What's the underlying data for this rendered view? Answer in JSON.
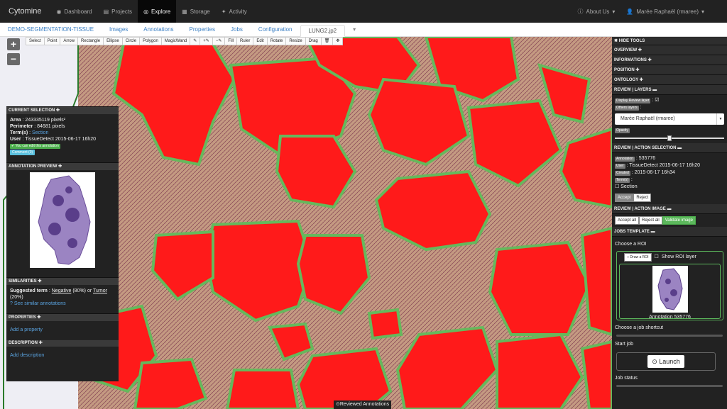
{
  "app": {
    "brand": "Cytomine"
  },
  "navbar": {
    "items": [
      {
        "label": "Dashboard",
        "icon": "dashboard-icon"
      },
      {
        "label": "Projects",
        "icon": "folder-icon"
      },
      {
        "label": "Explore",
        "icon": "eye-icon"
      },
      {
        "label": "Storage",
        "icon": "storage-icon"
      },
      {
        "label": "Activity",
        "icon": "fire-icon"
      }
    ],
    "about": "About Us",
    "user": "Marée Raphaël (rmaree)"
  },
  "subnav": {
    "tabs": [
      "DEMO-SEGMENTATION-TISSUE",
      "Images",
      "Annotations",
      "Properties",
      "Jobs",
      "Configuration",
      "LUNG2.jp2"
    ]
  },
  "toolbar": {
    "tools": [
      "Select",
      "Point",
      "Arrow",
      "Rectangle",
      "Ellipse",
      "Circle",
      "Polygon",
      "MagicWand",
      "✎",
      "+✎",
      "−✎",
      "Fill",
      "Ruler",
      "Edit",
      "Rotate",
      "Resize",
      "Drag",
      "🗑",
      "✥"
    ]
  },
  "zoom": {
    "in": "+",
    "out": "−"
  },
  "left_panel": {
    "current_selection": {
      "title": "CURRENT SELECTION",
      "area_label": "Area",
      "area_value": ": 243335119 pixels²",
      "perimeter_label": "Perimeter",
      "perimeter_value": ": 84681 pixels",
      "terms_label": "Term(s)",
      "terms_value": "Section",
      "user_label": "User",
      "user_value": ": TissueDetect 2015-06-17 16h20",
      "edit_badge": "✔ You can edit this annotation",
      "comment_badge": "Comment (0)"
    },
    "annotation_preview": {
      "title": "ANNOTATION PREVIEW"
    },
    "similarities": {
      "title": "SIMILARITIES",
      "suggested_label": "Suggested term",
      "negative": "Negative",
      "negative_pct": "(80%) or",
      "tumor": "Tumor",
      "tumor_pct": "(20%)",
      "see_similar": "See similar annotations"
    },
    "properties": {
      "title": "PROPERTIES",
      "add": "Add a property"
    },
    "description": {
      "title": "DESCRIPTION",
      "add": "Add description"
    }
  },
  "right_panel": {
    "hide_tools": "HIDE TOOLS",
    "overview": "OVERVIEW",
    "informations": "INFORMATIONS",
    "position": "POSITION",
    "ontology": "ONTOLOGY",
    "review_layers": {
      "title": "REVIEW | LAYERS",
      "display_review": "Display Review layer",
      "others_layers": "Others layers",
      "select_value": "Marée Raphaël (rmaree)",
      "opacity": "Opacity",
      "opacity_value": 0.5
    },
    "review_action_selection": {
      "title": "REVIEW | ACTION SELECTION",
      "annotation_label": "Annotation",
      "annotation_value": ": 535776",
      "user_label": "User",
      "user_value": ": TissueDetect 2015-06-17 16h20",
      "created_label": "Created",
      "created_value": ": 2015-06-17 16h34",
      "terms_label": "Term(s)",
      "terms_value": ":",
      "section": "Section",
      "accept": "Accept",
      "reject": "Reject"
    },
    "review_action_image": {
      "title": "REVIEW | ACTION IMAGE",
      "accept_all": "Accept all",
      "reject_all": "Reject all",
      "validate": "Validate image"
    },
    "jobs_template": {
      "title": "JOBS TEMPLATE",
      "choose_roi": "Choose a ROI",
      "draw_roi": "Draw a ROI",
      "show_roi_layer": "Show ROI layer",
      "annotation_caption": "Annotation 535776",
      "choose_shortcut": "Choose a job shortcut",
      "start_job": "Start job",
      "launch": "Launch",
      "job_status": "Job status"
    }
  },
  "viewer": {
    "reviewed": "Reviewed Annotations"
  },
  "colors": {
    "tissue": "#cfa48b",
    "annotation": "#ff1a1a",
    "outline": "#66b85c",
    "panel": "#222222"
  }
}
